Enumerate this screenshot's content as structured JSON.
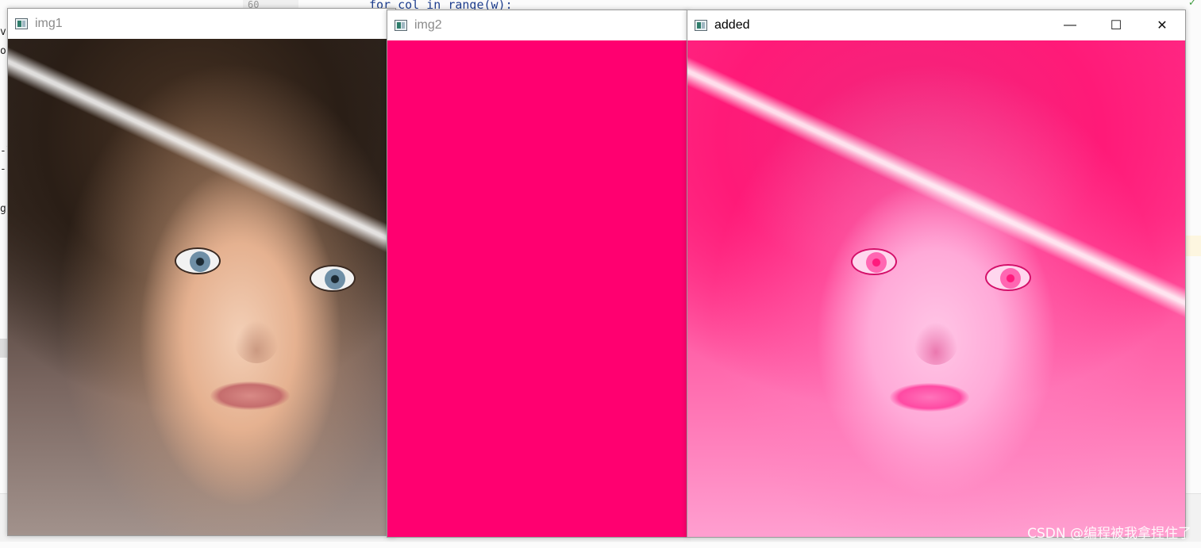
{
  "editor": {
    "code_line": "for col in range(w):",
    "gutter_line": "60",
    "side_fragments": [
      "vi",
      "ou",
      "-l",
      "-'",
      "g"
    ]
  },
  "windows": [
    {
      "id": "img1",
      "title": "img1",
      "active": false
    },
    {
      "id": "img2",
      "title": "img2",
      "active": false
    },
    {
      "id": "added",
      "title": "added",
      "active": true
    }
  ],
  "controls": {
    "minimize": "—",
    "maximize": "☐",
    "close": "✕"
  },
  "watermark": "CSDN @编程被我拿捏住了",
  "colors": {
    "img2_fill": "#ff0070",
    "accent_pink": "#ff1a78"
  }
}
